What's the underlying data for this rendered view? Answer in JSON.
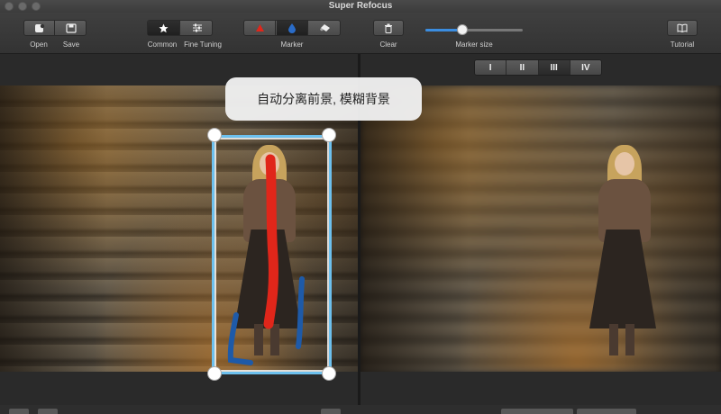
{
  "window": {
    "title": "Super Refocus"
  },
  "toolbar": {
    "open_label": "Open",
    "save_label": "Save",
    "common_label": "Common",
    "fine_tuning_label": "Fine Tuning",
    "marker_label": "Marker",
    "clear_label": "Clear",
    "marker_size_label": "Marker size",
    "marker_size_value": 0.38,
    "tutorial_label": "Tutorial"
  },
  "marker_colors": {
    "foreground": "#e0261a",
    "background": "#1e5aa8"
  },
  "tooltip": {
    "text": "自动分离前景, 模糊背景"
  },
  "view_segments": [
    "I",
    "II",
    "III",
    "IV"
  ],
  "icons": [
    "open-icon",
    "save-icon",
    "star-icon",
    "sliders-icon",
    "red-triangle-icon",
    "blue-drop-icon",
    "eraser-icon",
    "trash-icon",
    "book-icon"
  ]
}
